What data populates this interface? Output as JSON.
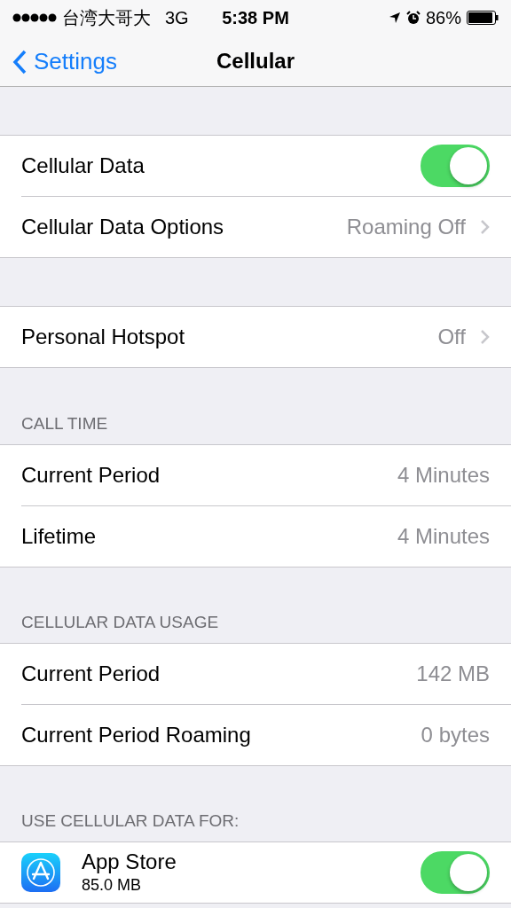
{
  "status_bar": {
    "carrier": "台湾大哥大",
    "network": "3G",
    "time": "5:38 PM",
    "battery": "86%"
  },
  "nav": {
    "back": "Settings",
    "title": "Cellular"
  },
  "sections": [
    {
      "rows": [
        {
          "kind": "toggle",
          "label": "Cellular Data",
          "on": true
        },
        {
          "kind": "disclosure",
          "label": "Cellular Data Options",
          "value": "Roaming Off"
        }
      ]
    },
    {
      "rows": [
        {
          "kind": "disclosure",
          "label": "Personal Hotspot",
          "value": "Off"
        }
      ]
    },
    {
      "header": "CALL TIME",
      "rows": [
        {
          "kind": "value",
          "label": "Current Period",
          "value": "4 Minutes"
        },
        {
          "kind": "value",
          "label": "Lifetime",
          "value": "4 Minutes"
        }
      ]
    },
    {
      "header": "CELLULAR DATA USAGE",
      "rows": [
        {
          "kind": "value",
          "label": "Current Period",
          "value": "142 MB"
        },
        {
          "kind": "value",
          "label": "Current Period Roaming",
          "value": "0 bytes"
        }
      ]
    },
    {
      "header": "USE CELLULAR DATA FOR:",
      "rows": [
        {
          "kind": "app",
          "label": "App Store",
          "sublabel": "85.0 MB",
          "on": true
        }
      ]
    }
  ]
}
